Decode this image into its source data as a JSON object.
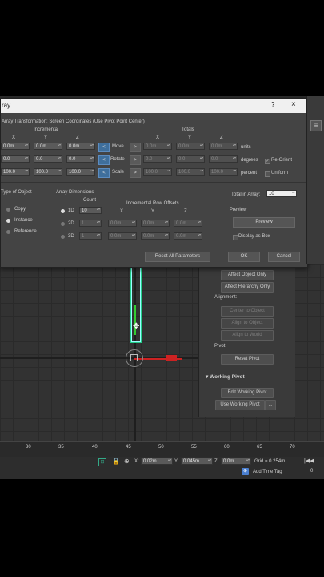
{
  "dialog": {
    "title": "ray",
    "help": "?",
    "close": "×",
    "transform_header": "Array Transformation: Screen Coordinates (Use Pivot Point Center)",
    "incremental": "Incremental",
    "totals": "Totals",
    "x": "X",
    "y": "Y",
    "z": "Z",
    "rows": [
      {
        "inc": [
          "0.0m",
          "0.0m",
          "0.0m"
        ],
        "label": "Move",
        "tot": [
          "0.0m",
          "0.0m",
          "0.0m"
        ],
        "unit": "units"
      },
      {
        "inc": [
          "0.0",
          "0.0",
          "0.0"
        ],
        "label": "Rotate",
        "tot": [
          "0.0",
          "0.0",
          "0.0"
        ],
        "unit": "degrees"
      },
      {
        "inc": [
          "100.0",
          "100.0",
          "100.0"
        ],
        "label": "Scale",
        "tot": [
          "100.0",
          "100.0",
          "100.0"
        ],
        "unit": "percent"
      }
    ],
    "re_orient": "Re-Orient",
    "uniform": "Uniform",
    "type_of_object": "Type of Object",
    "copy": "Copy",
    "instance": "Instance",
    "reference": "Reference",
    "array_dimensions": "Array Dimensions",
    "count": "Count",
    "inc_row_offsets": "Incremental Row Offsets",
    "d1": "1D",
    "d2": "2D",
    "d3": "3D",
    "count_1d": "10",
    "count_2d": "1",
    "count_3d": "1",
    "off2": [
      "0.0m",
      "0.0m",
      "0.0m"
    ],
    "off3": [
      "0.0m",
      "0.0m",
      "0.0m"
    ],
    "total_in_array_label": "Total in Array:",
    "total_in_array": "10",
    "preview_label": "Preview",
    "preview_btn": "Preview",
    "display_as_box": "Display as Box",
    "reset": "Reset All Parameters",
    "ok": "OK",
    "cancel": "Cancel"
  },
  "panel": {
    "affect_object": "Affect Object Only",
    "affect_hierarchy": "Affect Hierarchy Only",
    "alignment": "Alignment:",
    "center_to_object": "Center to Object",
    "align_to_object": "Align to Object",
    "align_to_world": "Align to World",
    "pivot": "Pivot:",
    "reset_pivot": "Reset Pivot",
    "working_pivot": "Working Pivot",
    "edit_working_pivot": "Edit Working Pivot",
    "use_working_pivot": "Use Working Pivot",
    "more": "..."
  },
  "ruler": {
    "ticks": [
      "30",
      "35",
      "40",
      "45",
      "50",
      "55",
      "60",
      "65",
      "70"
    ]
  },
  "status": {
    "x_label": "X:",
    "x": "0.02m",
    "y_label": "Y:",
    "y": "0.045m",
    "z_label": "Z:",
    "z": "0.0m",
    "grid": "Grid = 0.254m",
    "add_time_tag": "Add Time Tag",
    "frame": "0"
  }
}
